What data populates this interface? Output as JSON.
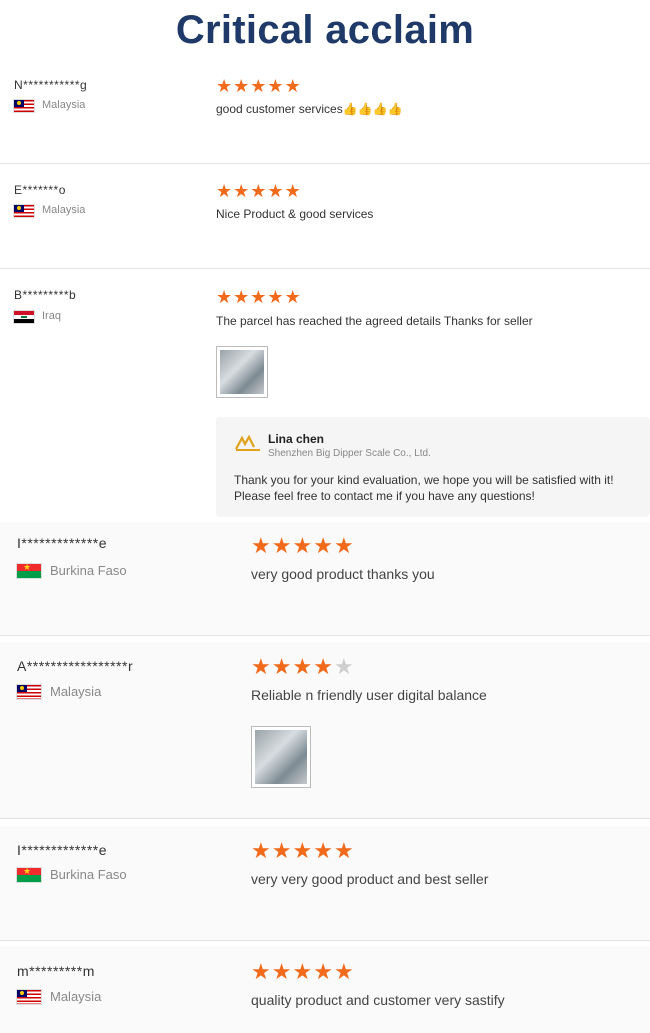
{
  "title": "Critical acclaim",
  "colors": {
    "title": "#1f3a68",
    "star": "#f26a1b",
    "star_off": "#cfcfcf"
  },
  "reviews": [
    {
      "name": "N***********g",
      "country": "Malaysia",
      "flag": "malaysia-flag",
      "rating": 5,
      "comment": "good customer services👍👍👍👍"
    },
    {
      "name": "E*******o",
      "country": "Malaysia",
      "flag": "malaysia-flag",
      "rating": 5,
      "comment": "Nice Product & good services"
    },
    {
      "name": "B*********b",
      "country": "Iraq",
      "flag": "iraq-flag",
      "rating": 5,
      "comment": "The parcel has reached the agreed details Thanks for seller",
      "reply": {
        "name": "Lina chen",
        "company": "Shenzhen Big Dipper Scale Co., Ltd.",
        "text": "Thank you for your kind evaluation, we hope you will be satisfied with it! Please feel free to contact me if you have any questions!"
      }
    },
    {
      "name": "I*************e",
      "country": "Burkina Faso",
      "flag": "burkina-faso-flag",
      "rating": 5,
      "comment": "very good product thanks you"
    },
    {
      "name": "A*****************r",
      "country": "Malaysia",
      "flag": "malaysia-flag",
      "rating": 4,
      "comment": "Reliable n friendly user digital balance"
    },
    {
      "name": "I*************e",
      "country": "Burkina Faso",
      "flag": "burkina-faso-flag",
      "rating": 5,
      "comment": "very very good product and best seller"
    },
    {
      "name": "m*********m",
      "country": "Malaysia",
      "flag": "malaysia-flag",
      "rating": 5,
      "comment": "quality product and customer very sastify"
    }
  ]
}
